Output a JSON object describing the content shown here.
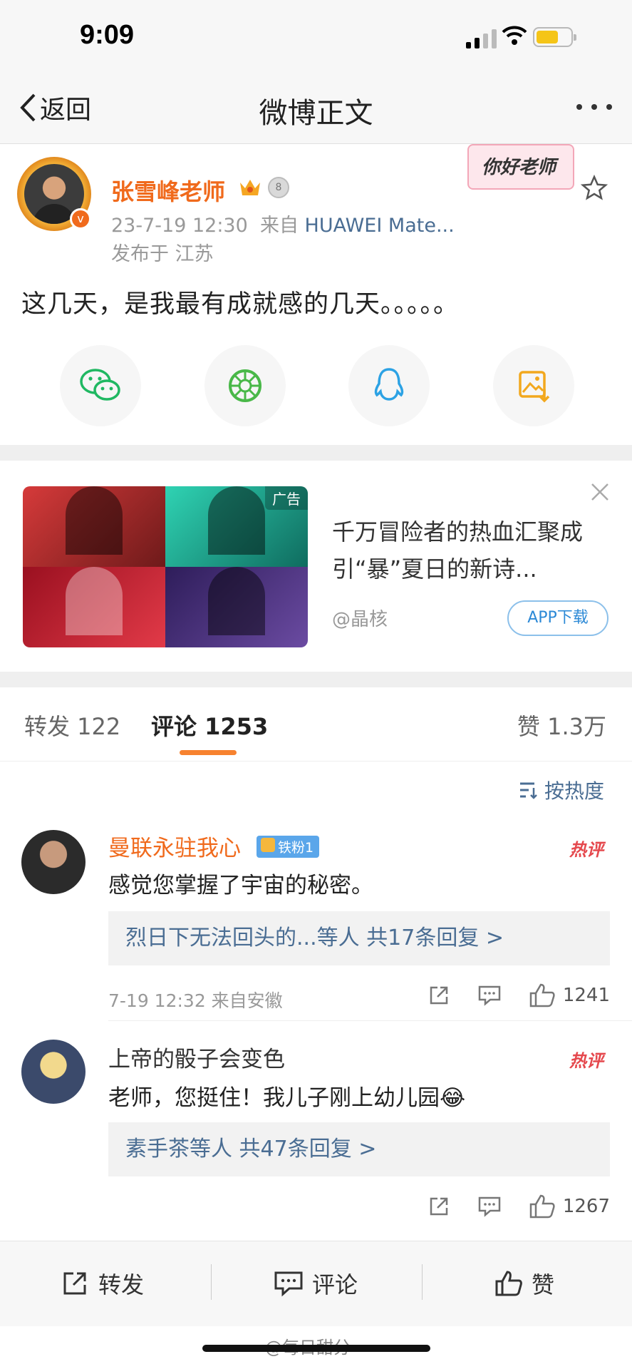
{
  "status_bar": {
    "time": "9:09"
  },
  "nav": {
    "back_label": "返回",
    "title": "微博正文"
  },
  "post": {
    "author": "张雪峰老师",
    "sticker_text": "你好老师",
    "date": "23-7-19 12:30",
    "from_prefix": "来自",
    "source": "HUAWEI Mate...",
    "location": "发布于 江苏",
    "text": "这几天，是我最有成就感的几天。。。。。"
  },
  "ad": {
    "tag": "广告",
    "headline": "千万冒险者的热血汇聚成引“暴”夏日的新诗...",
    "source": "@晶核",
    "download_label": "APP下载"
  },
  "tabs": {
    "reposts": "转发 122",
    "comments": "评论 1253",
    "likes": "赞 1.3万"
  },
  "sort_label": "按热度",
  "comments": [
    {
      "name": "曼联永驻我心",
      "fan_badge": "铁粉1",
      "hot": "热评",
      "text": "感觉您掌握了宇宙的秘密。",
      "replies": "烈日下无法回头的...等人  共17条回复 >",
      "time": "7-19 12:32  来自安徽",
      "likes": "1241"
    },
    {
      "name": "上帝的骰子会变色",
      "hot": "热评",
      "text": "老师，您挺住！我儿子刚上幼儿园😂",
      "replies": "素手茶等人  共47条回复 >",
      "time": "",
      "likes": "1267"
    }
  ],
  "bottom_bar": {
    "repost": "转发",
    "comment": "评论",
    "like": "赞"
  },
  "watermark": "@每日甜分"
}
